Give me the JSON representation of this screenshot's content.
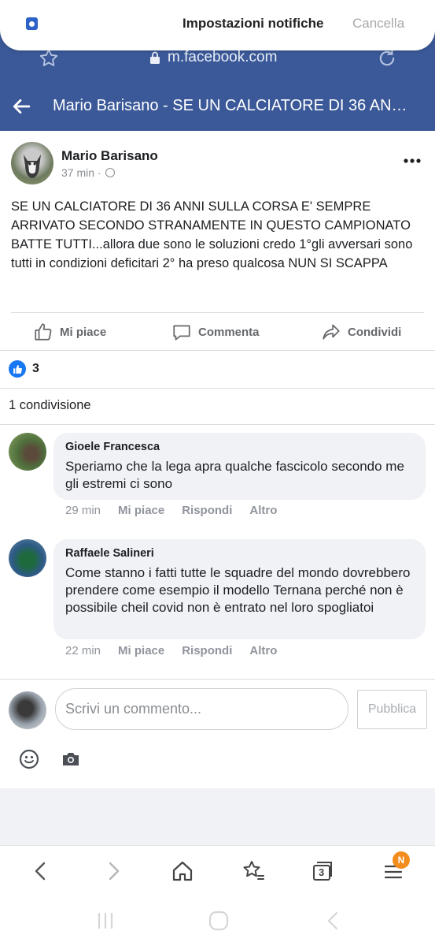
{
  "notification_sheet": {
    "title": "Impostazioni notifiche",
    "cancel_label": "Cancella"
  },
  "browser": {
    "url": "m.facebook.com",
    "tabs_count": "3",
    "menu_badge": "N"
  },
  "page_header": {
    "title": "Mario Barisano - SE UN CALCIATORE DI 36 ANNI SULLA CORSA E' SEMPRE"
  },
  "post": {
    "author": "Mario Barisano",
    "time": "37 min ·",
    "text": "SE UN CALCIATORE DI 36 ANNI SULLA CORSA E' SEMPRE ARRIVATO SECONDO STRANAMENTE IN QUESTO CAMPIONATO BATTE TUTTI...allora due sono le soluzioni credo 1°gli avversari sono tutti in condizioni deficitari 2° ha preso qualcosa NUN SI SCAPPA",
    "actions": {
      "like": "Mi piace",
      "comment": "Commenta",
      "share": "Condividi"
    },
    "reactions_count": "3",
    "shares_text": "1 condivisione"
  },
  "comments": [
    {
      "author": "Gioele Francesca",
      "text": "Speriamo che la lega apra qualche fascicolo secondo me gli estremi ci sono",
      "time": "29 min",
      "like": "Mi piace",
      "reply": "Rispondi",
      "more": "Altro"
    },
    {
      "author": "Raffaele Salineri",
      "text": "Come stanno i fatti tutte le squadre del mondo dovrebbero prendere come esempio il modello Ternana perché non è possibile cheil covid non è entrato nel loro spogliatoi",
      "time": "22 min",
      "like": "Mi piace",
      "reply": "Rispondi",
      "more": "Altro"
    }
  ],
  "composer": {
    "placeholder": "Scrivi un commento...",
    "publish_label": "Pubblica"
  },
  "colors": {
    "brand_blue": "#3b5998",
    "like_blue": "#1877f2",
    "badge_orange": "#f28c1c"
  }
}
